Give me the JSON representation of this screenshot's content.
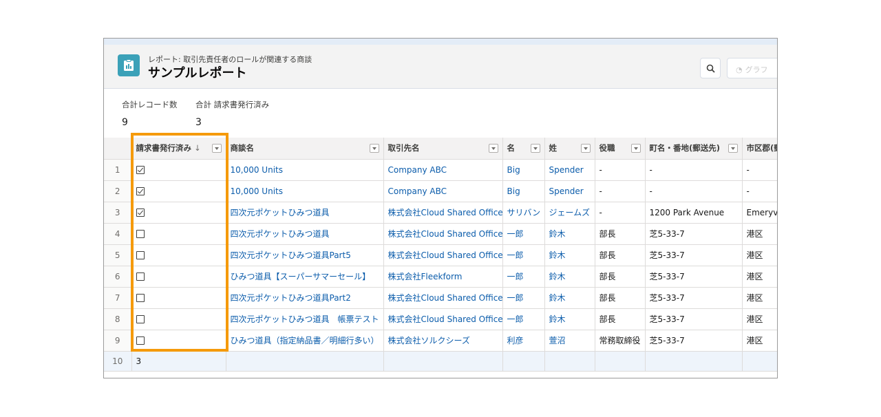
{
  "header": {
    "breadcrumb": "レポート: 取引先責任者のロールが関連する商談",
    "title": "サンプルレポート",
    "graph_button_label": "グラフ",
    "app_icon": "report-icon",
    "search_icon": "search-icon"
  },
  "summary": [
    {
      "label": "合計レコード数",
      "value": "9"
    },
    {
      "label": "合計 請求書発行済み",
      "value": "3"
    }
  ],
  "columns": [
    {
      "label": "請求書発行済み",
      "sort": "↓"
    },
    {
      "label": "商談名"
    },
    {
      "label": "取引先名"
    },
    {
      "label": "名"
    },
    {
      "label": "姓"
    },
    {
      "label": "役職"
    },
    {
      "label": "町名・番地(郵送先)"
    },
    {
      "label": "市区郡(郵"
    }
  ],
  "rows": [
    {
      "num": "1",
      "checked": true,
      "opp": "10,000 Units",
      "account": "Company ABC",
      "first": "Big",
      "last": "Spender",
      "title": "-",
      "street": "-",
      "city": "-"
    },
    {
      "num": "2",
      "checked": true,
      "opp": "10,000 Units",
      "account": "Company ABC",
      "first": "Big",
      "last": "Spender",
      "title": "-",
      "street": "-",
      "city": "-"
    },
    {
      "num": "3",
      "checked": true,
      "opp": "四次元ポケットひみつ道具",
      "account": "株式会社Cloud Shared Office",
      "first": "サリバン",
      "last": "ジェームズ",
      "title": "-",
      "street": "1200 Park Avenue",
      "city": "Emeryvi"
    },
    {
      "num": "4",
      "checked": false,
      "opp": "四次元ポケットひみつ道具",
      "account": "株式会社Cloud Shared Office",
      "first": "一郎",
      "last": "鈴木",
      "title": "部長",
      "street": "芝5-33-7",
      "city": "港区"
    },
    {
      "num": "5",
      "checked": false,
      "opp": "四次元ポケットひみつ道具Part5",
      "account": "株式会社Cloud Shared Office",
      "first": "一郎",
      "last": "鈴木",
      "title": "部長",
      "street": "芝5-33-7",
      "city": "港区"
    },
    {
      "num": "6",
      "checked": false,
      "opp": "ひみつ道具【スーパーサマーセール】",
      "account": "株式会社Fleekform",
      "first": "一郎",
      "last": "鈴木",
      "title": "部長",
      "street": "芝5-33-7",
      "city": "港区"
    },
    {
      "num": "7",
      "checked": false,
      "opp": "四次元ポケットひみつ道具Part2",
      "account": "株式会社Cloud Shared Office",
      "first": "一郎",
      "last": "鈴木",
      "title": "部長",
      "street": "芝5-33-7",
      "city": "港区"
    },
    {
      "num": "8",
      "checked": false,
      "opp": "四次元ポケットひみつ道具　帳票テスト",
      "account": "株式会社Cloud Shared Office",
      "first": "一郎",
      "last": "鈴木",
      "title": "部長",
      "street": "芝5-33-7",
      "city": "港区"
    },
    {
      "num": "9",
      "checked": false,
      "opp": "ひみつ道具（指定納品書／明細行多い）",
      "account": "株式会社ソルクシーズ",
      "first": "利彦",
      "last": "萱沼",
      "title": "常務取締役",
      "street": "芝5-33-7",
      "city": "港区"
    }
  ],
  "total_row": {
    "num": "10",
    "value": "3"
  },
  "colors": {
    "link": "#0b5cab",
    "highlight": "#f59a0b",
    "icon_bg": "#3ba1b8"
  }
}
